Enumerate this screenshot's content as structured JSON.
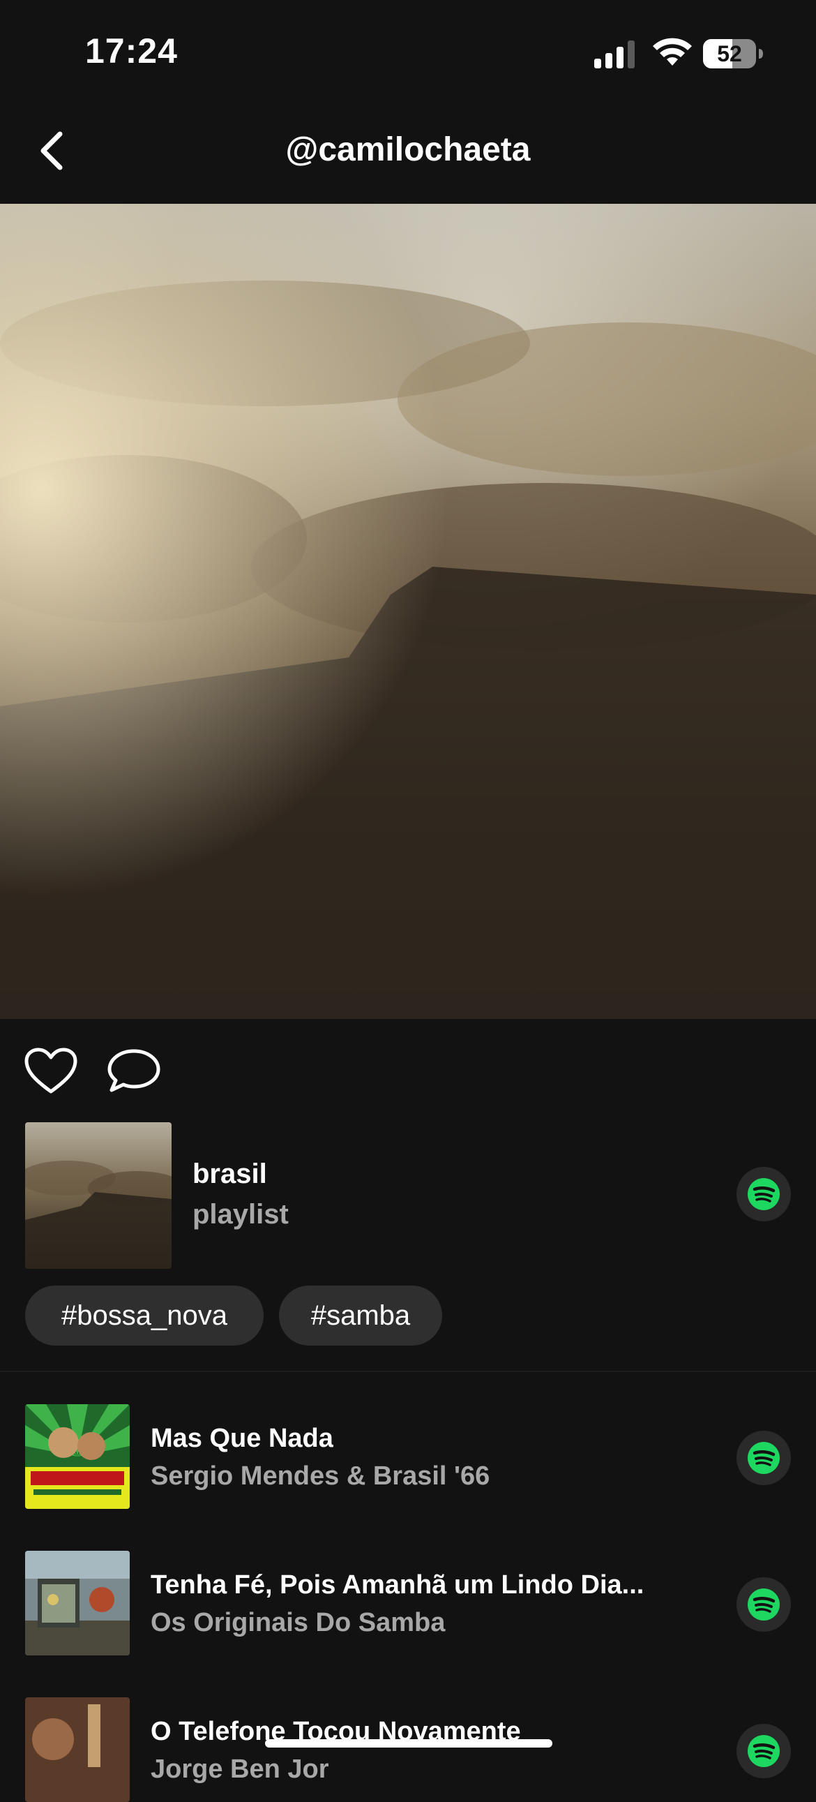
{
  "status_bar": {
    "time": "17:24",
    "battery": "52"
  },
  "header": {
    "title": "@camilochaeta"
  },
  "playlist": {
    "name": "brasil",
    "type": "playlist"
  },
  "tags": [
    "#bossa_nova",
    "#samba"
  ],
  "tracks": [
    {
      "title": "Mas Que Nada",
      "artist": "Sergio Mendes & Brasil '66"
    },
    {
      "title": "Tenha Fé, Pois Amanhã um Lindo Dia...",
      "artist": "Os Originais Do Samba"
    },
    {
      "title": "O Telefone Tocou Novamente",
      "artist": "Jorge Ben Jor"
    }
  ],
  "icons": {
    "back": "chevron-left-icon",
    "like": "heart-icon",
    "comment": "comment-bubble-icon",
    "spotify": "spotify-icon"
  },
  "colors": {
    "spotify_green": "#1ed760",
    "background": "#121212",
    "tag_bg": "#2f2f2f"
  }
}
